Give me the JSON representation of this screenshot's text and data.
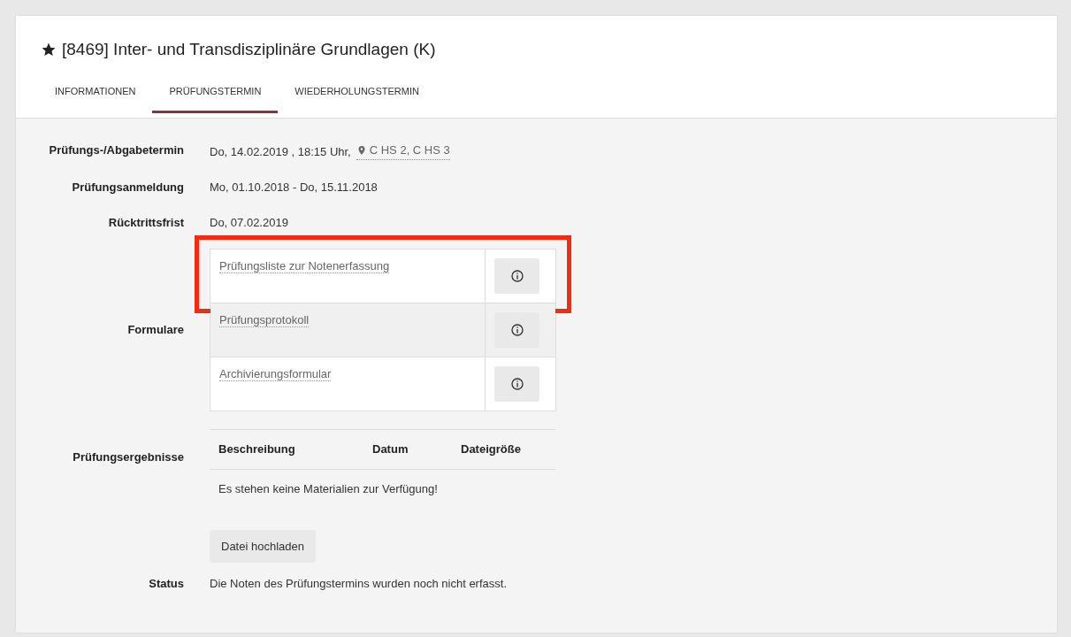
{
  "title": "[8469] Inter- und Transdisziplinäre Grundlagen (K)",
  "tabs": [
    {
      "label": "INFORMATIONEN",
      "selected": false
    },
    {
      "label": "PRÜFUNGSTERMIN",
      "selected": true
    },
    {
      "label": "WIEDERHOLUNGSTERMIN",
      "selected": false
    }
  ],
  "details": [
    {
      "kind": "date_location",
      "label": "Prüfungs-/Abgabetermin",
      "value": "Do, 14.02.2019 , 18:15 Uhr,",
      "location": "C HS 2, C HS 3"
    },
    {
      "kind": "text",
      "label": "Prüfungsanmeldung",
      "value": "Mo, 01.10.2018 - Do, 15.11.2018"
    },
    {
      "kind": "text",
      "label": "Rücktrittsfrist",
      "value": "Do, 07.02.2019"
    },
    {
      "kind": "forms",
      "label": "Formulare",
      "forms": [
        {
          "name": "Prüfungsliste zur Notenerfassung",
          "shaded": false,
          "highlighted": true
        },
        {
          "name": "Prüfungsprotokoll",
          "shaded": true,
          "highlighted": false
        },
        {
          "name": "Archivierungsformular",
          "shaded": false,
          "highlighted": false
        }
      ]
    },
    {
      "kind": "results",
      "label": "Prüfungsergebnisse",
      "columns": [
        "Beschreibung",
        "Datum",
        "Dateigröße"
      ],
      "empty_message": "Es stehen keine Materialien zur Verfügung!",
      "upload_button": "Datei hochladen"
    },
    {
      "kind": "text",
      "label": "Status",
      "value": "Die Noten des Prüfungstermins wurden noch nicht erfasst."
    }
  ]
}
